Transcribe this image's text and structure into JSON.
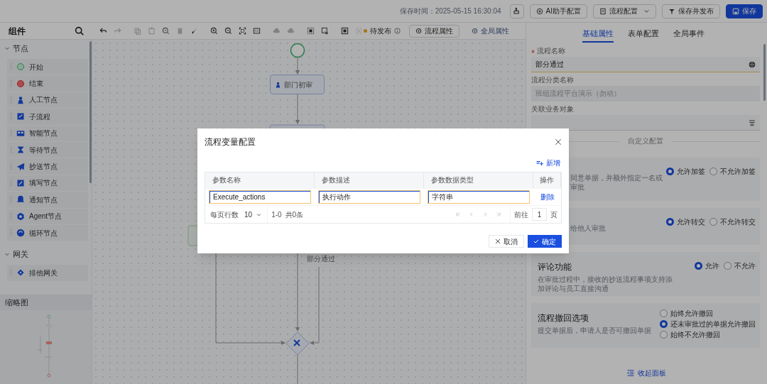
{
  "header": {
    "save_time": "保存时间：2025-05-15 16:30:04",
    "buttons": [
      {
        "label": "AI助手配置",
        "kind": "ai"
      },
      {
        "label": "流程配置",
        "kind": "dropdown"
      },
      {
        "label": "保存并发布",
        "kind": "publish"
      },
      {
        "label": "保存",
        "kind": "primary"
      }
    ]
  },
  "toolbar": {
    "status": "待发布",
    "tabs": [
      {
        "label": "流程属性",
        "selected": true
      },
      {
        "label": "全局属性",
        "selected": false
      }
    ]
  },
  "sidebar": {
    "title": "组件",
    "sections": [
      {
        "title": "节点",
        "expanded": true,
        "items": [
          {
            "label": "开始",
            "kind": "start"
          },
          {
            "label": "结束",
            "kind": "end"
          },
          {
            "label": "人工节点",
            "kind": "user"
          },
          {
            "label": "子流程",
            "kind": "subprocess"
          },
          {
            "label": "智能节点",
            "kind": "smart"
          },
          {
            "label": "等待节点",
            "kind": "wait"
          },
          {
            "label": "抄送节点",
            "kind": "send"
          },
          {
            "label": "填写节点",
            "kind": "write"
          },
          {
            "label": "通知节点",
            "kind": "notify"
          },
          {
            "label": "Agent节点",
            "kind": "agent"
          },
          {
            "label": "循环节点",
            "kind": "loop"
          }
        ]
      },
      {
        "title": "网关",
        "expanded": true,
        "items": [
          {
            "label": "排他网关",
            "kind": "gateway"
          }
        ]
      }
    ],
    "minimap": {
      "title": "缩略图"
    }
  },
  "canvas": {
    "task_label": "部门初审",
    "edge_label": "部分通过"
  },
  "modal": {
    "title": "流程变量配置",
    "add_label": "新增",
    "columns": [
      "参数名称",
      "参数描述",
      "参数数据类型",
      "操作"
    ],
    "rows": [
      {
        "name": "Execute_actions",
        "description": "执行动作",
        "type": "字符串",
        "action": "删除"
      }
    ],
    "pagination": {
      "rows_per_page_label": "每页行数",
      "rows_per_page": "10",
      "range": "1-0",
      "total": "共0条",
      "goto_label": "前往",
      "page": "1",
      "page_suffix": "页"
    },
    "buttons": [
      {
        "label": "取消",
        "kind": "cancel"
      },
      {
        "label": "确定",
        "kind": "confirm"
      }
    ]
  },
  "panel": {
    "tabs": [
      {
        "label": "基础属性",
        "selected": true
      },
      {
        "label": "表单配置",
        "selected": false
      },
      {
        "label": "全局事件",
        "selected": false
      }
    ],
    "fields": [
      {
        "label": "流程名称",
        "required": true,
        "value": "部分通过",
        "disabled": false,
        "kind": "globe"
      },
      {
        "label": "流程分类名称",
        "required": false,
        "value": "班组流程平台演示（勿动）",
        "disabled": true,
        "kind": "plain"
      },
      {
        "label": "关联业务对象",
        "required": false,
        "disabled": false,
        "kind": "picker"
      }
    ],
    "divider": "自定义配置",
    "cards": [
      {
        "kind": "partial",
        "description_lines": [
          "同意单据，并额外指定一名或",
          "审批"
        ],
        "options": [
          {
            "label": "允许加签",
            "selected": true
          },
          {
            "label": "不允许加签",
            "selected": false
          }
        ]
      },
      {
        "kind": "partial",
        "description_lines": [
          "给他人审批"
        ],
        "options": [
          {
            "label": "允许转交",
            "selected": true
          },
          {
            "label": "不允许转交",
            "selected": false
          }
        ]
      },
      {
        "kind": "full",
        "title": "评论功能",
        "description_lines": [
          "在审批过程中，接收的抄送流程事项支持添",
          "加评论与员工直接沟通"
        ],
        "options": [
          {
            "label": "允许",
            "selected": true
          },
          {
            "label": "不允许",
            "selected": false
          }
        ]
      },
      {
        "kind": "full",
        "title": "流程撤回选项",
        "description_lines": [
          "提交单据后，申请人是否可撤回单据"
        ],
        "options": [
          {
            "label": "始终允许撤回",
            "selected": false
          },
          {
            "label": "还未审批过的单据允许撤回",
            "selected": true
          },
          {
            "label": "始终不允许撤回",
            "selected": false
          }
        ]
      }
    ],
    "collapse_label": "收起面板"
  }
}
